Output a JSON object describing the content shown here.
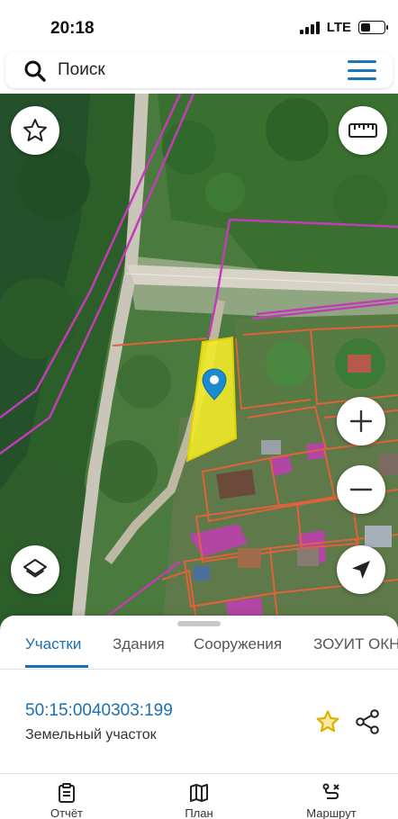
{
  "status_bar": {
    "time": "20:18",
    "network": "LTE",
    "signal_bars": 4
  },
  "search": {
    "placeholder": "Поиск",
    "icon": "search-icon",
    "menu_icon": "menu-icon"
  },
  "map": {
    "highlight_color": "#f2ea2a",
    "boundary_color": "#e0613a",
    "zone_color": "#c23db5",
    "buttons": {
      "favorite": "star-outline-icon",
      "ruler": "ruler-icon",
      "zoom_in": "plus-icon",
      "zoom_out": "minus-icon",
      "layers": "layers-icon",
      "location": "navigation-arrow-icon"
    }
  },
  "sheet": {
    "tabs": [
      {
        "label": "Участки",
        "active": true
      },
      {
        "label": "Здания",
        "active": false
      },
      {
        "label": "Сооружения",
        "active": false
      },
      {
        "label": "ЗОУИТ ОКН",
        "active": false
      }
    ],
    "parcel": {
      "number": "50:15:0040303:199",
      "type": "Земельный участок"
    }
  },
  "bottom_nav": [
    {
      "label": "Отчёт",
      "icon": "report-icon"
    },
    {
      "label": "План",
      "icon": "map-plan-icon"
    },
    {
      "label": "Маршрут",
      "icon": "route-icon"
    }
  ],
  "colors": {
    "accent": "#1b6fb3",
    "favorite_star": "#f2c400"
  }
}
